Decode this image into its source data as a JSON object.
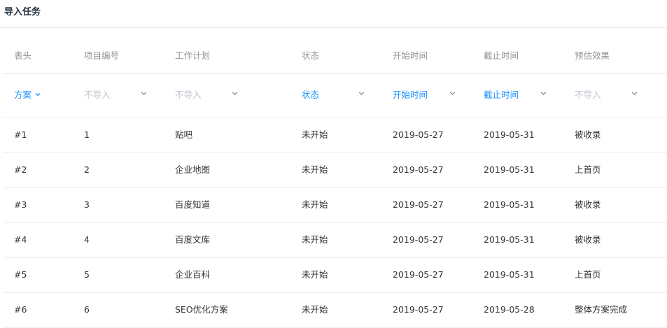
{
  "title": "导入任务",
  "columns": [
    "表头",
    "项目编号",
    "工作计划",
    "状态",
    "开始时间",
    "截止时间",
    "预估效果"
  ],
  "selects": [
    "方案",
    "不导入",
    "不导入",
    "状态",
    "开始时间",
    "截止时间",
    "不导入"
  ],
  "rows": [
    [
      "#1",
      "1",
      "贴吧",
      "未开始",
      "2019-05-27",
      "2019-05-31",
      "被收录"
    ],
    [
      "#2",
      "2",
      "企业地图",
      "未开始",
      "2019-05-27",
      "2019-05-31",
      "上首页"
    ],
    [
      "#3",
      "3",
      "百度知道",
      "未开始",
      "2019-05-27",
      "2019-05-31",
      "被收录"
    ],
    [
      "#4",
      "4",
      "百度文库",
      "未开始",
      "2019-05-27",
      "2019-05-31",
      "被收录"
    ],
    [
      "#5",
      "5",
      "企业百科",
      "未开始",
      "2019-05-27",
      "2019-05-31",
      "上首页"
    ],
    [
      "#6",
      "6",
      "SEO优化方案",
      "未开始",
      "2019-05-27",
      "2019-05-28",
      "整体方案完成"
    ]
  ],
  "accent": "#1890ff"
}
